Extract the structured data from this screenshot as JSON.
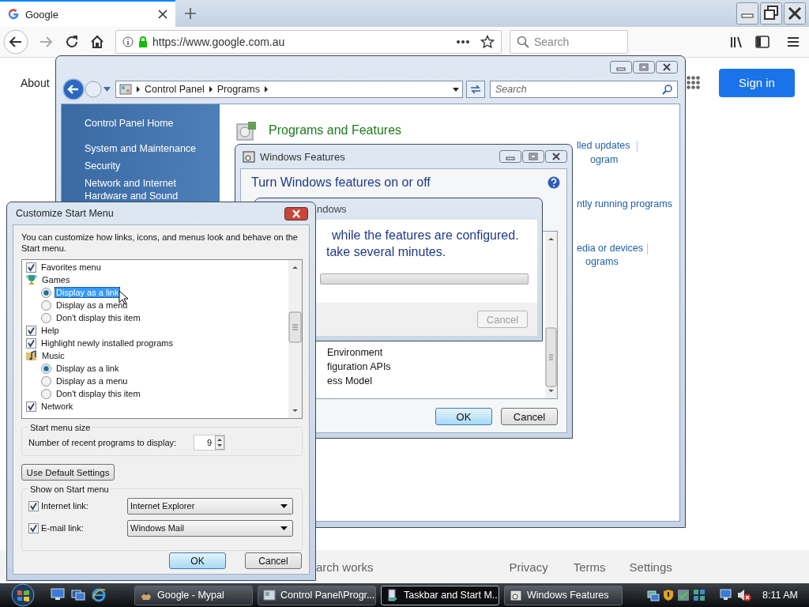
{
  "browser": {
    "tab": {
      "title": "Google",
      "selected": true
    },
    "address": {
      "value": "https://www.google.com.au"
    },
    "search": {
      "placeholder": "Search"
    }
  },
  "google_page": {
    "about_link": "About",
    "sign_in_button": "Sign in",
    "footer_links": [
      "arch works",
      "Privacy",
      "Terms",
      "Settings"
    ]
  },
  "control_panel": {
    "breadcrumb": [
      "Control Panel",
      "Programs"
    ],
    "search": {
      "placeholder": "Search"
    },
    "sidebar": {
      "items": [
        "Control Panel Home",
        "System and Maintenance",
        "Security",
        "Network and Internet",
        "Hardware and Sound"
      ]
    },
    "heading": "Programs and Features",
    "link_fragments": [
      "lled updates",
      "ogram",
      "ntly running programs",
      "edia or devices",
      "ograms"
    ]
  },
  "windows_features": {
    "title": "Windows Features",
    "heading": "Turn Windows features on or off",
    "list_fragments": [
      "Environment",
      "figuration APIs",
      "ess Model"
    ],
    "buttons": [
      {
        "label": "OK",
        "default": true
      },
      {
        "label": "Cancel",
        "default": false
      }
    ],
    "progress_dialog": {
      "title": "ndows",
      "message_lines": [
        "while the features are configured.",
        "take several minutes."
      ],
      "level": 0,
      "cancel": {
        "label": "Cancel",
        "disabled": true
      }
    }
  },
  "customize_start_menu": {
    "title": "Customize Start Menu",
    "description": "You can customize how links, icons, and menus look and behave on the Start menu.",
    "items": [
      {
        "kind": "checkbox",
        "label": "Favorites menu",
        "checked": true
      },
      {
        "kind": "group",
        "label": "Games"
      },
      {
        "kind": "radio",
        "label": "Display as a link",
        "selected": true,
        "focused": true
      },
      {
        "kind": "radio",
        "label": "Display as a menu",
        "selected": false,
        "focused": false
      },
      {
        "kind": "radio",
        "label": "Don't display this item",
        "selected": false,
        "focused": false
      },
      {
        "kind": "checkbox",
        "label": "Help",
        "checked": true
      },
      {
        "kind": "checkbox",
        "label": "Highlight newly installed programs",
        "checked": true
      },
      {
        "kind": "group",
        "label": "Music"
      },
      {
        "kind": "radio",
        "label": "Display as a link",
        "selected": true,
        "focused": false
      },
      {
        "kind": "radio",
        "label": "Display as a menu",
        "selected": false,
        "focused": false
      },
      {
        "kind": "radio",
        "label": "Don't display this item",
        "selected": false,
        "focused": false
      },
      {
        "kind": "checkbox",
        "label": "Network",
        "checked": true
      }
    ],
    "size_group": {
      "title": "Start menu size",
      "label": "Number of recent programs to display:",
      "value": "9"
    },
    "default_button": "Use Default Settings",
    "show_group": {
      "title": "Show on Start menu",
      "rows": [
        {
          "label": "Internet link:",
          "checked": true,
          "value": "Internet Explorer"
        },
        {
          "label": "E-mail link:",
          "checked": true,
          "value": "Windows Mail"
        }
      ]
    },
    "buttons": [
      {
        "label": "OK",
        "default": true
      },
      {
        "label": "Cancel",
        "default": false
      }
    ]
  },
  "taskbar": {
    "items": [
      {
        "label": "Google - Mypal",
        "selected": false
      },
      {
        "label": "Control Panel\\Progr...",
        "selected": false
      },
      {
        "label": "Taskbar and Start M...",
        "selected": true
      },
      {
        "label": "Windows Features",
        "selected": false
      }
    ],
    "clock": "8:11 AM"
  }
}
